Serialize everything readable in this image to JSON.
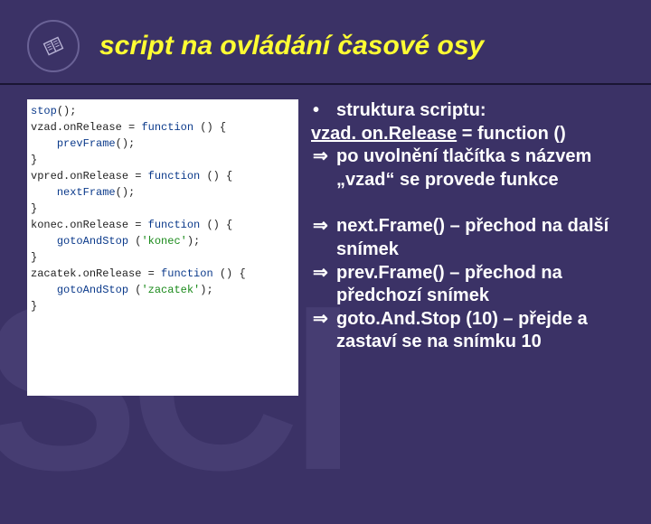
{
  "header": {
    "title": "script na ovládání časové osy"
  },
  "code": {
    "lines": [
      {
        "segments": [
          {
            "t": "stop",
            "c": "fn"
          },
          {
            "t": "();",
            "c": "op"
          }
        ]
      },
      {
        "segments": [
          {
            "t": "vzad",
            "c": "id"
          },
          {
            "t": ".",
            "c": "op"
          },
          {
            "t": "onRelease",
            "c": "id"
          },
          {
            "t": " = ",
            "c": "op"
          },
          {
            "t": "function",
            "c": "kw"
          },
          {
            "t": " () {",
            "c": "op"
          }
        ]
      },
      {
        "segments": [
          {
            "t": "    ",
            "c": "op"
          },
          {
            "t": "prevFrame",
            "c": "fn"
          },
          {
            "t": "();",
            "c": "op"
          }
        ]
      },
      {
        "segments": [
          {
            "t": "}",
            "c": "op"
          }
        ]
      },
      {
        "segments": [
          {
            "t": "",
            "c": "op"
          }
        ]
      },
      {
        "segments": [
          {
            "t": "vpred",
            "c": "id"
          },
          {
            "t": ".",
            "c": "op"
          },
          {
            "t": "onRelease",
            "c": "id"
          },
          {
            "t": " = ",
            "c": "op"
          },
          {
            "t": "function",
            "c": "kw"
          },
          {
            "t": " () {",
            "c": "op"
          }
        ]
      },
      {
        "segments": [
          {
            "t": "    ",
            "c": "op"
          },
          {
            "t": "nextFrame",
            "c": "fn"
          },
          {
            "t": "();",
            "c": "op"
          }
        ]
      },
      {
        "segments": [
          {
            "t": "}",
            "c": "op"
          }
        ]
      },
      {
        "segments": [
          {
            "t": "",
            "c": "op"
          }
        ]
      },
      {
        "segments": [
          {
            "t": "",
            "c": "op"
          }
        ]
      },
      {
        "segments": [
          {
            "t": "konec",
            "c": "id"
          },
          {
            "t": ".",
            "c": "op"
          },
          {
            "t": "onRelease",
            "c": "id"
          },
          {
            "t": " = ",
            "c": "op"
          },
          {
            "t": "function",
            "c": "kw"
          },
          {
            "t": " () {",
            "c": "op"
          }
        ]
      },
      {
        "segments": [
          {
            "t": "    ",
            "c": "op"
          },
          {
            "t": "gotoAndStop",
            "c": "fn"
          },
          {
            "t": " (",
            "c": "op"
          },
          {
            "t": "'konec'",
            "c": "str"
          },
          {
            "t": ");",
            "c": "op"
          }
        ]
      },
      {
        "segments": [
          {
            "t": "}",
            "c": "op"
          }
        ]
      },
      {
        "segments": [
          {
            "t": "zacatek",
            "c": "id"
          },
          {
            "t": ".",
            "c": "op"
          },
          {
            "t": "onRelease",
            "c": "id"
          },
          {
            "t": " = ",
            "c": "op"
          },
          {
            "t": "function",
            "c": "kw"
          },
          {
            "t": " () {",
            "c": "op"
          }
        ]
      },
      {
        "segments": [
          {
            "t": "    ",
            "c": "op"
          },
          {
            "t": "gotoAndStop",
            "c": "fn"
          },
          {
            "t": " (",
            "c": "op"
          },
          {
            "t": "'zacatek'",
            "c": "str"
          },
          {
            "t": ");",
            "c": "op"
          }
        ]
      },
      {
        "segments": [
          {
            "t": "}",
            "c": "op"
          }
        ]
      }
    ]
  },
  "bullets": {
    "b1": "struktura scriptu:",
    "b2_pre": "vzad. on.Release",
    "b2_post": " = function ()",
    "b3": "po uvolnění tlačítka s názvem „vzad“ se provede funkce",
    "b4": "next.Frame() – přechod na další snímek",
    "b5": "prev.Frame() – přechod na předchozí snímek",
    "b6": "goto.And.Stop (10) – přejde a zastaví se na snímku 10"
  },
  "bg": "SCI"
}
